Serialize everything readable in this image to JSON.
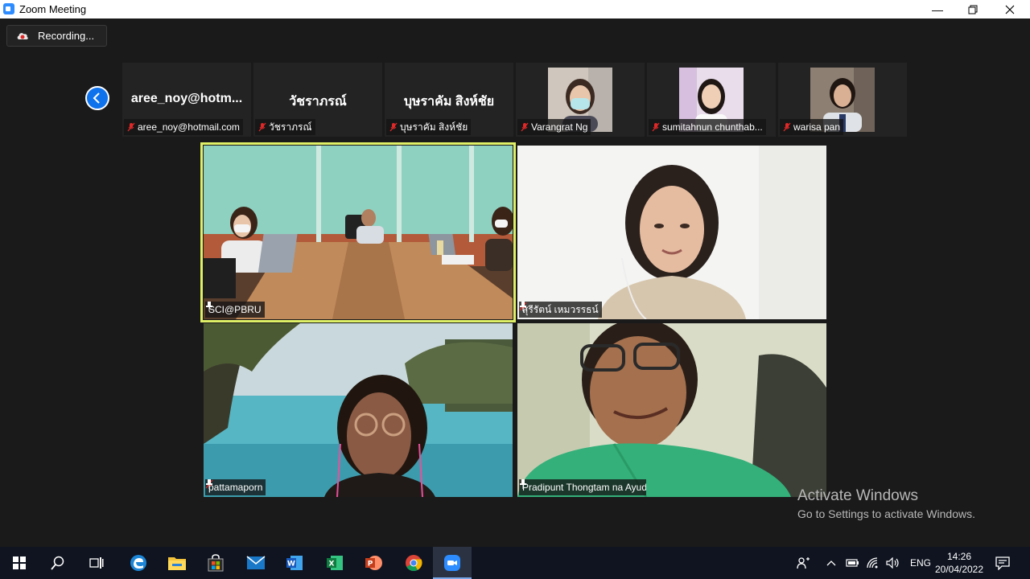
{
  "window": {
    "title": "Zoom Meeting",
    "controls": [
      "minimize-icon",
      "restore-icon",
      "close-icon"
    ]
  },
  "recording": {
    "label": "Recording..."
  },
  "strip": [
    {
      "center_name": "aree_noy@hotm...",
      "label": "aree_noy@hotmail.com",
      "muted": true,
      "video": false
    },
    {
      "center_name": "วัชราภรณ์",
      "label": "วัชราภรณ์",
      "muted": true,
      "video": false
    },
    {
      "center_name": "บุษราคัม  สิงห์ชัย",
      "label": "บุษราคัม  สิงห์ชัย",
      "muted": true,
      "video": false
    },
    {
      "label": "Varangrat Ng",
      "muted": true,
      "video": true
    },
    {
      "label": "sumitahnun chunthab...",
      "muted": true,
      "video": true
    },
    {
      "label": "warisa pan",
      "muted": true,
      "video": true
    }
  ],
  "gallery": [
    {
      "label": "SCI@PBRU",
      "muted": false,
      "pinned": true,
      "active": true,
      "scene": "meeting-room"
    },
    {
      "label": "สุรีรัตน์ เหมวรรธน์",
      "muted": true,
      "pinned": true,
      "active": false,
      "scene": "woman-white-wall"
    },
    {
      "label": "pattamaporn",
      "muted": true,
      "pinned": true,
      "active": false,
      "scene": "blue-pond"
    },
    {
      "label": "Pradipunt Thongtam na Ayudhaya",
      "muted": false,
      "pinned": true,
      "active": false,
      "scene": "man-green-shirt"
    }
  ],
  "watermark": {
    "line1": "Activate Windows",
    "line2": "Go to Settings to activate Windows."
  },
  "taskbar": {
    "apps": [
      "windows-start-icon",
      "search-icon",
      "task-view-icon",
      "edge-icon",
      "file-explorer-icon",
      "store-icon",
      "mail-icon",
      "word-icon",
      "excel-icon",
      "powerpoint-icon",
      "chrome-icon",
      "zoom-icon"
    ],
    "active_app": "zoom-icon",
    "language": "ENG",
    "time": "14:26",
    "date": "20/04/2022"
  },
  "colors": {
    "active_speaker_outline": "#dff066",
    "zoom_blue": "#0e72ed",
    "muted_red": "#e02828"
  }
}
